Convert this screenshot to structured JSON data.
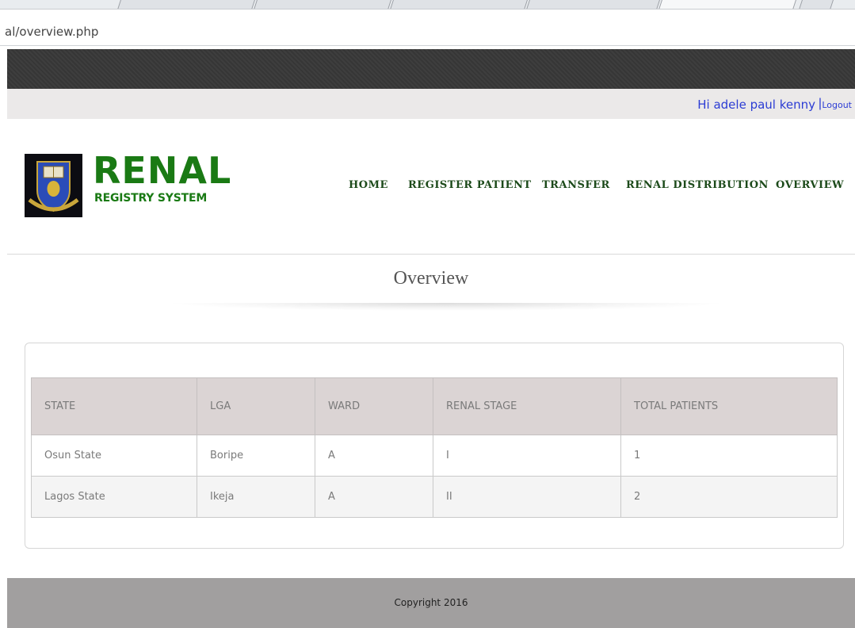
{
  "browser": {
    "url": "al/overview.php"
  },
  "user": {
    "greeting": "Hi adele paul kenny",
    "separator": "|",
    "logout": "Logout"
  },
  "brand": {
    "title": "RENAL",
    "subtitle": "REGISTRY SYSTEM"
  },
  "nav": [
    "HOME",
    "REGISTER PATIENT",
    "TRANSFER",
    "RENAL DISTRIBUTION",
    "OVERVIEW"
  ],
  "page": {
    "title": "Overview"
  },
  "table": {
    "headers": [
      "STATE",
      "LGA",
      "WARD",
      "RENAL STAGE",
      "TOTAL PATIENTS"
    ],
    "rows": [
      [
        "Osun State",
        "Boripe",
        "A",
        "I",
        "1"
      ],
      [
        "Lagos State",
        "Ikeja",
        "A",
        "II",
        "2"
      ]
    ]
  },
  "footer": {
    "copyright": "Copyright 2016"
  },
  "colors": {
    "brand_green": "#1a7a14",
    "nav_green": "#1c4a1a",
    "link_blue": "#2b3cd4",
    "header_bg": "#dbd4d4",
    "footer_bg": "#a19f9f"
  }
}
